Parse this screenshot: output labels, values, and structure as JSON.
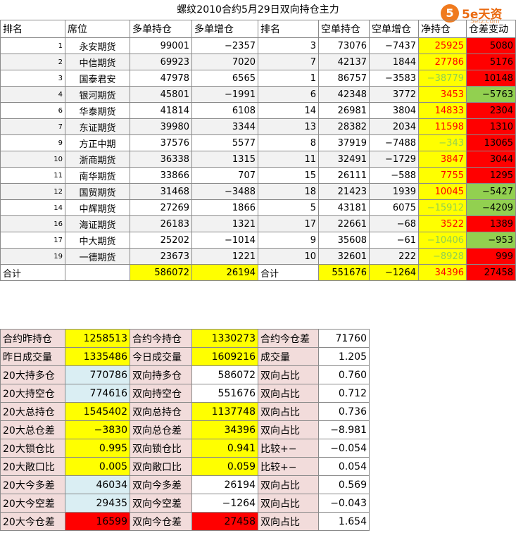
{
  "title": "螺纹2010合约5月29日双向持仓主力",
  "logo": {
    "mark": "5",
    "brand": "5e天资",
    "sub": "5etz.com"
  },
  "headers": [
    "排名",
    "席位",
    "多单持仓",
    "多单增仓",
    "排名",
    "空单持仓",
    "空单增仓",
    "净持仓",
    "仓差变动"
  ],
  "rows": [
    {
      "rank_long": "1",
      "seat": "永安期货",
      "long_pos": "99001",
      "long_chg": "−2357",
      "rank_short": "3",
      "short_pos": "73076",
      "short_chg": "−7437",
      "net": "25925",
      "net_color": "red",
      "diff": "5080",
      "diff_bg": "red"
    },
    {
      "rank_long": "2",
      "seat": "中信期货",
      "long_pos": "69923",
      "long_chg": "7020",
      "rank_short": "7",
      "short_pos": "42137",
      "short_chg": "1844",
      "net": "27786",
      "net_color": "red",
      "diff": "5176",
      "diff_bg": "red"
    },
    {
      "rank_long": "3",
      "seat": "国泰君安",
      "long_pos": "47978",
      "long_chg": "6565",
      "rank_short": "1",
      "short_pos": "86757",
      "short_chg": "−3583",
      "net": "−38779",
      "net_color": "green",
      "diff": "10148",
      "diff_bg": "red"
    },
    {
      "rank_long": "4",
      "seat": "银河期货",
      "long_pos": "45801",
      "long_chg": "−1991",
      "rank_short": "6",
      "short_pos": "42348",
      "short_chg": "3772",
      "net": "3453",
      "net_color": "red",
      "diff": "−5763",
      "diff_bg": "green"
    },
    {
      "rank_long": "6",
      "seat": "华泰期货",
      "long_pos": "41814",
      "long_chg": "6108",
      "rank_short": "14",
      "short_pos": "26981",
      "short_chg": "3804",
      "net": "14833",
      "net_color": "red",
      "diff": "2304",
      "diff_bg": "red"
    },
    {
      "rank_long": "7",
      "seat": "东证期货",
      "long_pos": "39980",
      "long_chg": "3344",
      "rank_short": "13",
      "short_pos": "28382",
      "short_chg": "2034",
      "net": "11598",
      "net_color": "red",
      "diff": "1310",
      "diff_bg": "red"
    },
    {
      "rank_long": "9",
      "seat": "方正中期",
      "long_pos": "37576",
      "long_chg": "5577",
      "rank_short": "8",
      "short_pos": "37919",
      "short_chg": "−7488",
      "net": "−343",
      "net_color": "green",
      "diff": "13065",
      "diff_bg": "red"
    },
    {
      "rank_long": "10",
      "seat": "浙商期货",
      "long_pos": "36338",
      "long_chg": "1315",
      "rank_short": "11",
      "short_pos": "32491",
      "short_chg": "−1729",
      "net": "3847",
      "net_color": "red",
      "diff": "3044",
      "diff_bg": "red"
    },
    {
      "rank_long": "11",
      "seat": "南华期货",
      "long_pos": "33866",
      "long_chg": "707",
      "rank_short": "15",
      "short_pos": "26111",
      "short_chg": "−588",
      "net": "7755",
      "net_color": "red",
      "diff": "1295",
      "diff_bg": "red"
    },
    {
      "rank_long": "12",
      "seat": "国贸期货",
      "long_pos": "31468",
      "long_chg": "−3488",
      "rank_short": "18",
      "short_pos": "21423",
      "short_chg": "1939",
      "net": "10045",
      "net_color": "red",
      "diff": "−5427",
      "diff_bg": "green"
    },
    {
      "rank_long": "14",
      "seat": "中辉期货",
      "long_pos": "27269",
      "long_chg": "1866",
      "rank_short": "5",
      "short_pos": "43181",
      "short_chg": "6075",
      "net": "−15912",
      "net_color": "green",
      "diff": "−4209",
      "diff_bg": "green"
    },
    {
      "rank_long": "16",
      "seat": "海证期货",
      "long_pos": "26183",
      "long_chg": "1321",
      "rank_short": "17",
      "short_pos": "22661",
      "short_chg": "−68",
      "net": "3522",
      "net_color": "red",
      "diff": "1389",
      "diff_bg": "red"
    },
    {
      "rank_long": "17",
      "seat": "中大期货",
      "long_pos": "25202",
      "long_chg": "−1014",
      "rank_short": "9",
      "short_pos": "35608",
      "short_chg": "−61",
      "net": "−10406",
      "net_color": "green",
      "diff": "−953",
      "diff_bg": "green"
    },
    {
      "rank_long": "19",
      "seat": "一德期货",
      "long_pos": "23673",
      "long_chg": "1221",
      "rank_short": "10",
      "short_pos": "32601",
      "short_chg": "222",
      "net": "−8928",
      "net_color": "green",
      "diff": "999",
      "diff_bg": "red"
    }
  ],
  "total": {
    "label_a": "合计",
    "long_pos": "586072",
    "long_chg": "26194",
    "label_b": "合计",
    "short_pos": "551676",
    "short_chg": "−1264",
    "net": "34396",
    "diff": "27458"
  },
  "stats": [
    {
      "l1": "合约昨持仓",
      "v1": "1258513",
      "v1_bg": "yel",
      "l2": "合约今持仓",
      "v2": "1330273",
      "v2_bg": "yel",
      "l3": "合约今仓差",
      "v3": "71760"
    },
    {
      "l1": "昨日成交量",
      "v1": "1335486",
      "v1_bg": "yel",
      "l2": "今日成交量",
      "v2": "1609216",
      "v2_bg": "yel",
      "l3": "成交量",
      "v3": "1.205"
    },
    {
      "l1": "20大持多仓",
      "v1": "770786",
      "v1_bg": "blu",
      "l2": "双向持多仓",
      "v2": "586072",
      "v2_bg": "",
      "l3": "双向占比",
      "v3": "0.760"
    },
    {
      "l1": "20大持空仓",
      "v1": "774616",
      "v1_bg": "blu",
      "l2": "双向持空仓",
      "v2": "551676",
      "v2_bg": "",
      "l3": "双向占比",
      "v3": "0.712"
    },
    {
      "l1": "20大总持仓",
      "v1": "1545402",
      "v1_bg": "yel",
      "l2": "双向总持仓",
      "v2": "1137748",
      "v2_bg": "yel",
      "l3": "双向占比",
      "v3": "0.736"
    },
    {
      "l1": "20大总仓差",
      "v1": "−3830",
      "v1_bg": "yel",
      "l2": "双向总仓差",
      "v2": "34396",
      "v2_bg": "yel",
      "l3": "双向占比",
      "v3": "−8.981"
    },
    {
      "l1": "20大锁仓比",
      "v1": "0.995",
      "v1_bg": "yel",
      "l2": "双向锁仓比",
      "v2": "0.941",
      "v2_bg": "yel",
      "l3": "比较+−",
      "v3": "−0.054"
    },
    {
      "l1": "20大敞口比",
      "v1": "0.005",
      "v1_bg": "yel",
      "l2": "双向敞口比",
      "v2": "0.059",
      "v2_bg": "yel",
      "l3": "比较+−",
      "v3": "0.054"
    },
    {
      "l1": "20大今多差",
      "v1": "46034",
      "v1_bg": "blu",
      "l2": "双向今多差",
      "v2": "26194",
      "v2_bg": "",
      "l3": "双向占比",
      "v3": "0.569"
    },
    {
      "l1": "20大今空差",
      "v1": "29435",
      "v1_bg": "blu",
      "l2": "双向今空差",
      "v2": "−1264",
      "v2_bg": "",
      "l3": "双向占比",
      "v3": "−0.043"
    },
    {
      "l1": "20大今仓差",
      "v1": "16599",
      "v1_bg": "red",
      "l2": "双向今仓差",
      "v2": "27458",
      "v2_bg": "red",
      "l3": "双向占比",
      "v3": "1.654"
    }
  ]
}
